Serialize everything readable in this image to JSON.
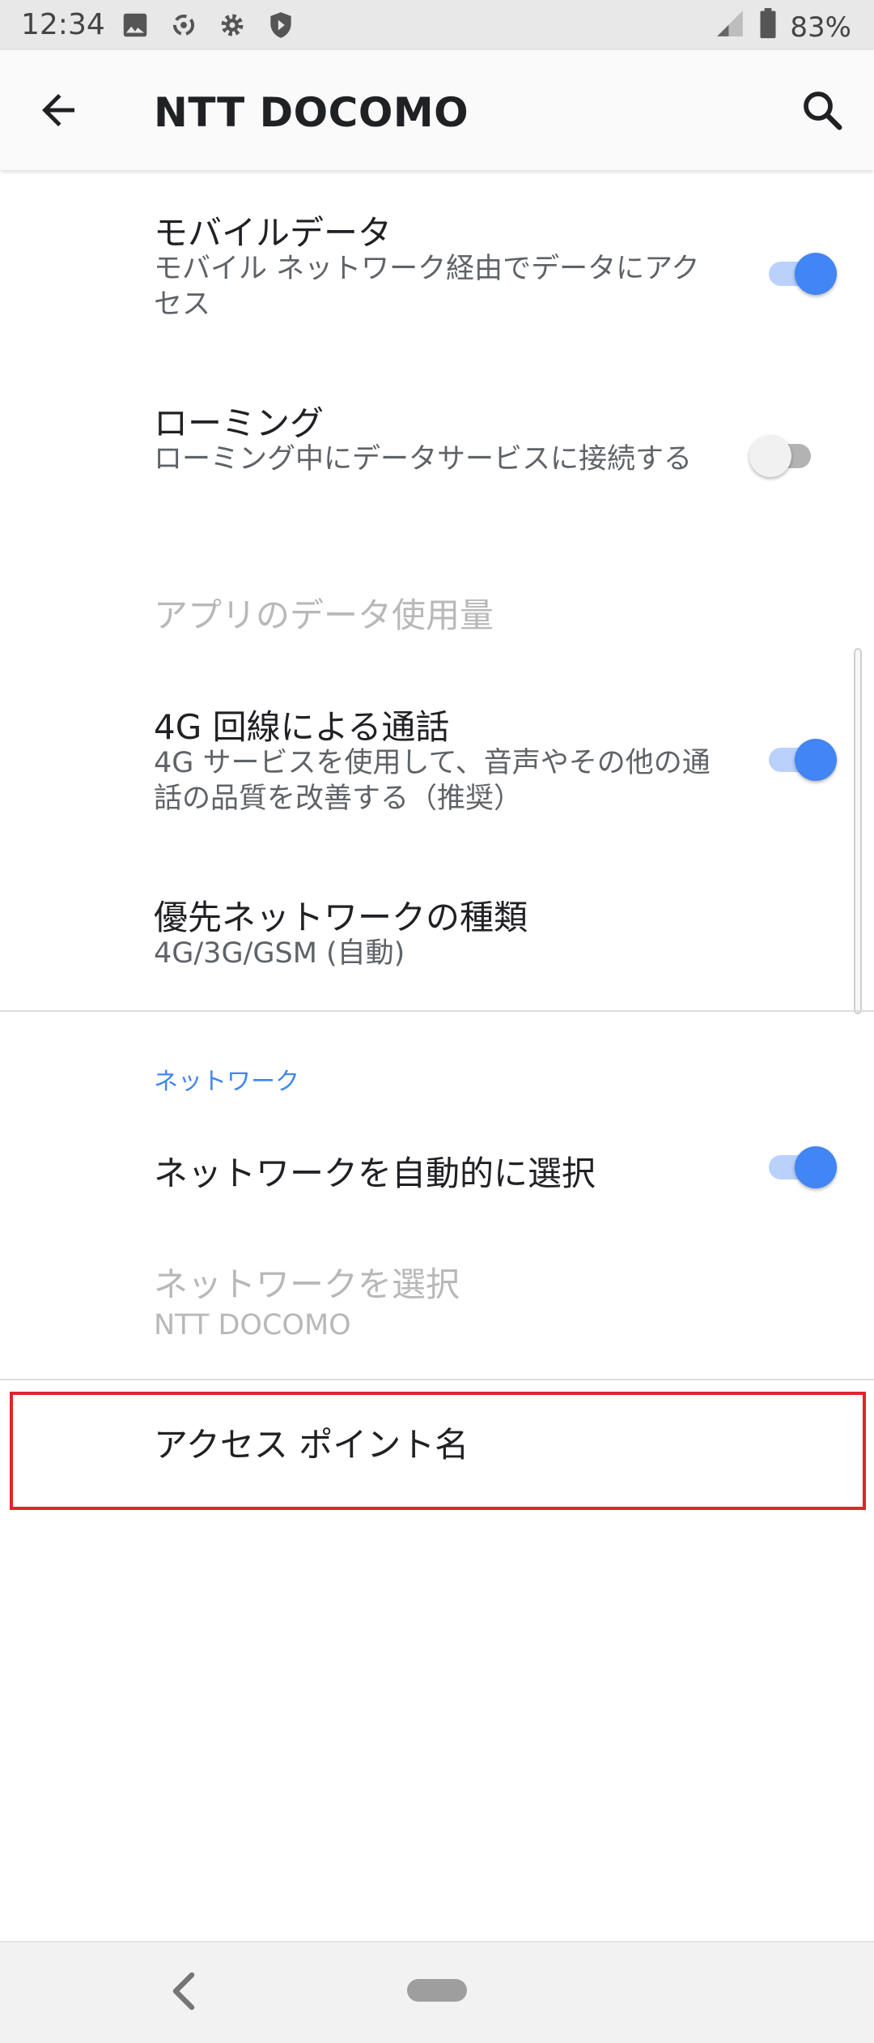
{
  "status_bar": {
    "time": "12:34",
    "battery": "83%",
    "icons": [
      "image-icon",
      "sync-icon",
      "settings-icon",
      "shield-icon",
      "signal-icon",
      "battery-icon"
    ]
  },
  "app_bar": {
    "title": "NTT DOCOMO"
  },
  "settings": {
    "mobile_data": {
      "title": "モバイルデータ",
      "summary": "モバイル ネットワーク経由でデータにアクセス",
      "enabled": true
    },
    "roaming": {
      "title": "ローミング",
      "summary": "ローミング中にデータサービスに接続する",
      "enabled": false
    },
    "app_data_usage": {
      "title": "アプリのデータ使用量"
    },
    "volte": {
      "title": "4G 回線による通話",
      "summary": "4G サービスを使用して、音声やその他の通話の品質を改善する（推奨）",
      "enabled": true
    },
    "preferred_network": {
      "title": "優先ネットワークの種類",
      "summary": "4G/3G/GSM (自動)"
    }
  },
  "network_section": {
    "header": "ネットワーク",
    "auto_select": {
      "title": "ネットワークを自動的に選択",
      "enabled": true
    },
    "choose_network": {
      "title": "ネットワークを選択",
      "summary": "NTT DOCOMO"
    }
  },
  "access_point": {
    "title": "アクセス ポイント名"
  },
  "colors": {
    "accent": "#4285f4",
    "highlight": "#e0242c"
  }
}
